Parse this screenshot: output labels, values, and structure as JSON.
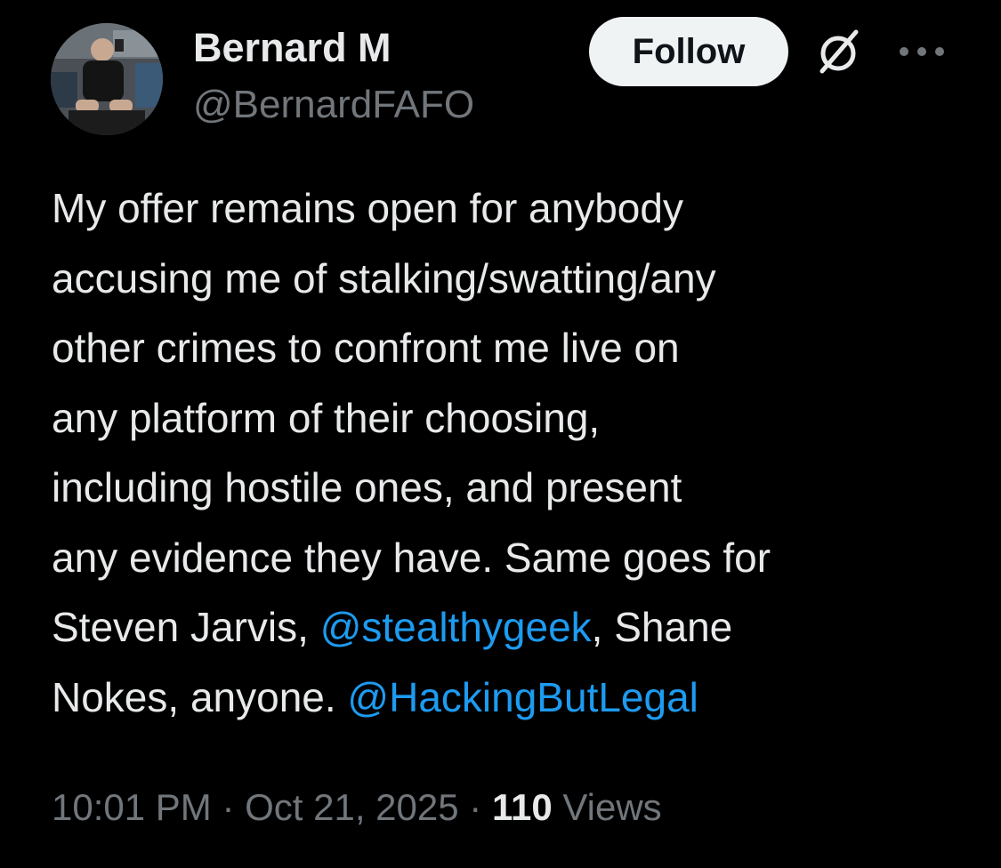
{
  "author": {
    "display_name": "Bernard M",
    "handle": "@BernardFAFO"
  },
  "actions": {
    "follow_label": "Follow",
    "grok_icon": "grok-icon",
    "more_icon": "more-dots-icon"
  },
  "tweet": {
    "lines": {
      "l1": "My offer remains open for anybody",
      "l2": "accusing me of stalking/swatting/any",
      "l3": "other crimes to confront me live on",
      "l4": "any platform of their choosing,",
      "l5": "including hostile ones, and present",
      "l6": "any evidence they have. Same goes for",
      "l7_before": "Steven Jarvis, ",
      "l7_mention": "@stealthygeek",
      "l7_after": ", Shane",
      "l8_before": "Nokes, anyone. ",
      "l8_mention": "@HackingButLegal"
    }
  },
  "meta": {
    "time": "10:01 PM",
    "separator": " · ",
    "date": "Oct 21, 2025",
    "views_count": "110",
    "views_label": "Views"
  },
  "colors": {
    "background": "#000000",
    "text": "#E7E9EA",
    "secondary": "#71767B",
    "link": "#1D9BF0",
    "follow_bg": "#EFF3F4"
  }
}
